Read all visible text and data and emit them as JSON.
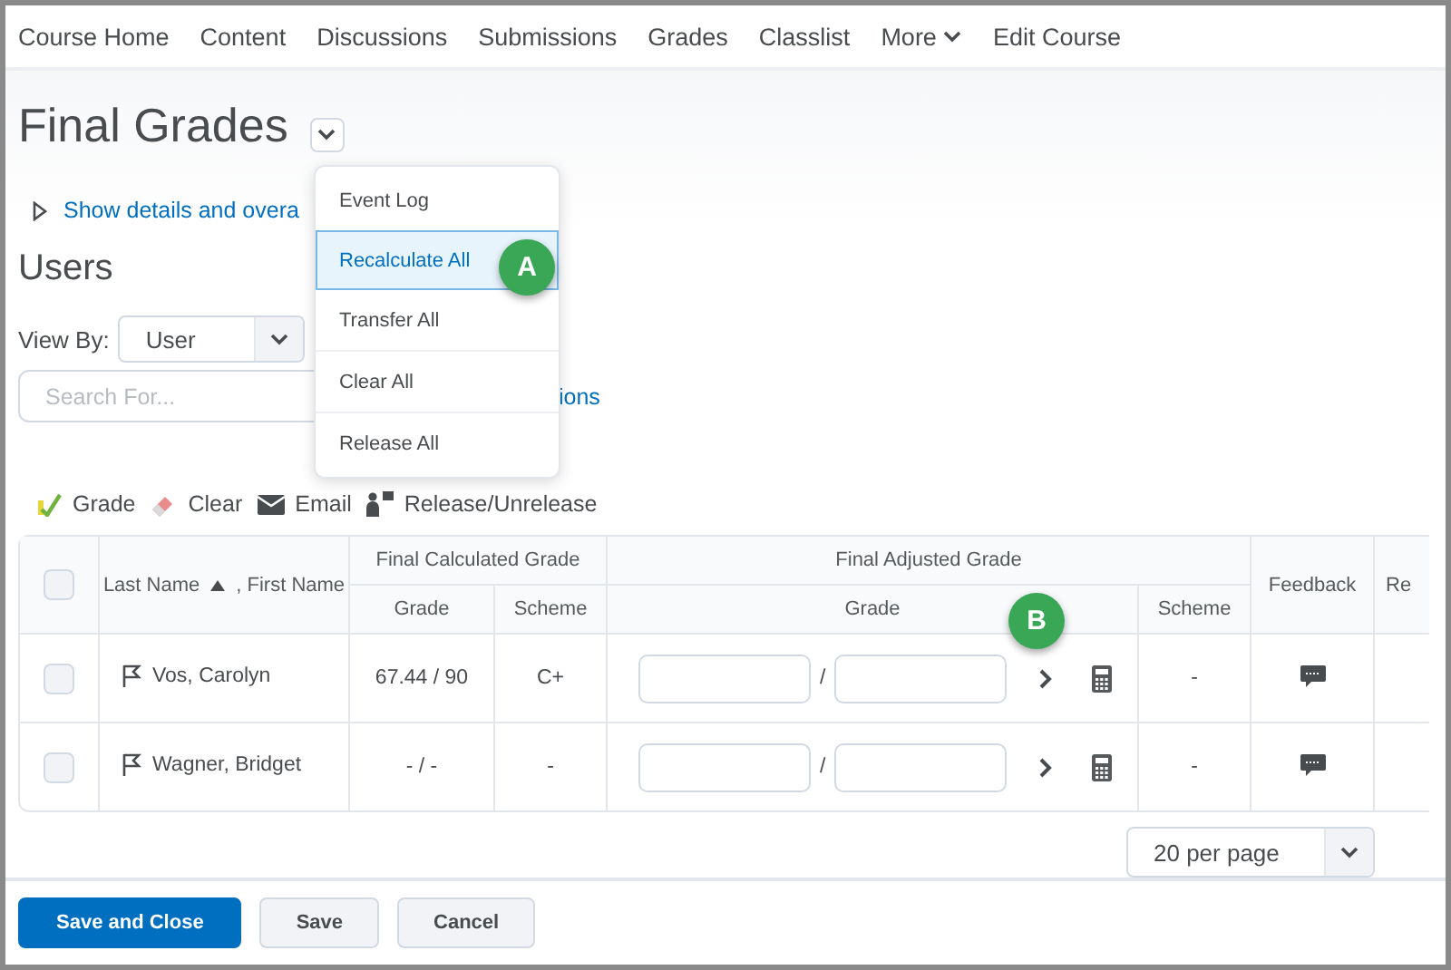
{
  "nav": [
    {
      "label": "Course Home",
      "kind": "link"
    },
    {
      "label": "Content",
      "kind": "link"
    },
    {
      "label": "Discussions",
      "kind": "link"
    },
    {
      "label": "Submissions",
      "kind": "link"
    },
    {
      "label": "Grades",
      "kind": "link"
    },
    {
      "label": "Classlist",
      "kind": "link"
    },
    {
      "label": "More",
      "kind": "menu"
    },
    {
      "label": "Edit Course",
      "kind": "link"
    }
  ],
  "title": "Final Grades",
  "details_link": "Show details and overa",
  "menu": [
    {
      "label": "Event Log",
      "selected": false
    },
    {
      "label": "Recalculate All",
      "selected": true
    },
    {
      "label": "Transfer All",
      "selected": false
    },
    {
      "label": "Clear All",
      "selected": false
    },
    {
      "label": "Release All",
      "selected": false
    }
  ],
  "callouts": [
    "A",
    "B"
  ],
  "section_title": "Users",
  "view_by": {
    "label": "View By:",
    "value": "User"
  },
  "search": {
    "placeholder": "Search For..."
  },
  "search_options_link": "ions",
  "toolbar": [
    {
      "label": "Grade",
      "kind": "grade"
    },
    {
      "label": "Clear",
      "kind": "clear"
    },
    {
      "label": "Email",
      "kind": "email"
    },
    {
      "label": "Release/Unrelease",
      "kind": "release"
    }
  ],
  "table": {
    "select_all_checked": false,
    "name_header_parts": [
      "Last Name",
      ", First Name"
    ],
    "group_headers": [
      "Final Calculated Grade",
      "Final Adjusted Grade"
    ],
    "sub_headers": [
      "Grade",
      "Scheme",
      "Grade",
      "Scheme"
    ],
    "feedback_header": "Feedback",
    "column_cut": "Re",
    "rows": [
      {
        "checked": false,
        "name": "Vos, Carolyn",
        "grade": "67.44 / 90",
        "scheme": "C+",
        "adjusted_separator": "/",
        "adjusted_scheme": "-"
      },
      {
        "checked": false,
        "name": "Wagner, Bridget",
        "grade": "- / -",
        "scheme": "-",
        "adjusted_separator": "/",
        "adjusted_scheme": "-"
      }
    ]
  },
  "per_page": "20 per page",
  "buttons": [
    {
      "label": "Save and Close",
      "kind": "primary"
    },
    {
      "label": "Save",
      "kind": "secondary"
    },
    {
      "label": "Cancel",
      "kind": "secondary"
    }
  ]
}
